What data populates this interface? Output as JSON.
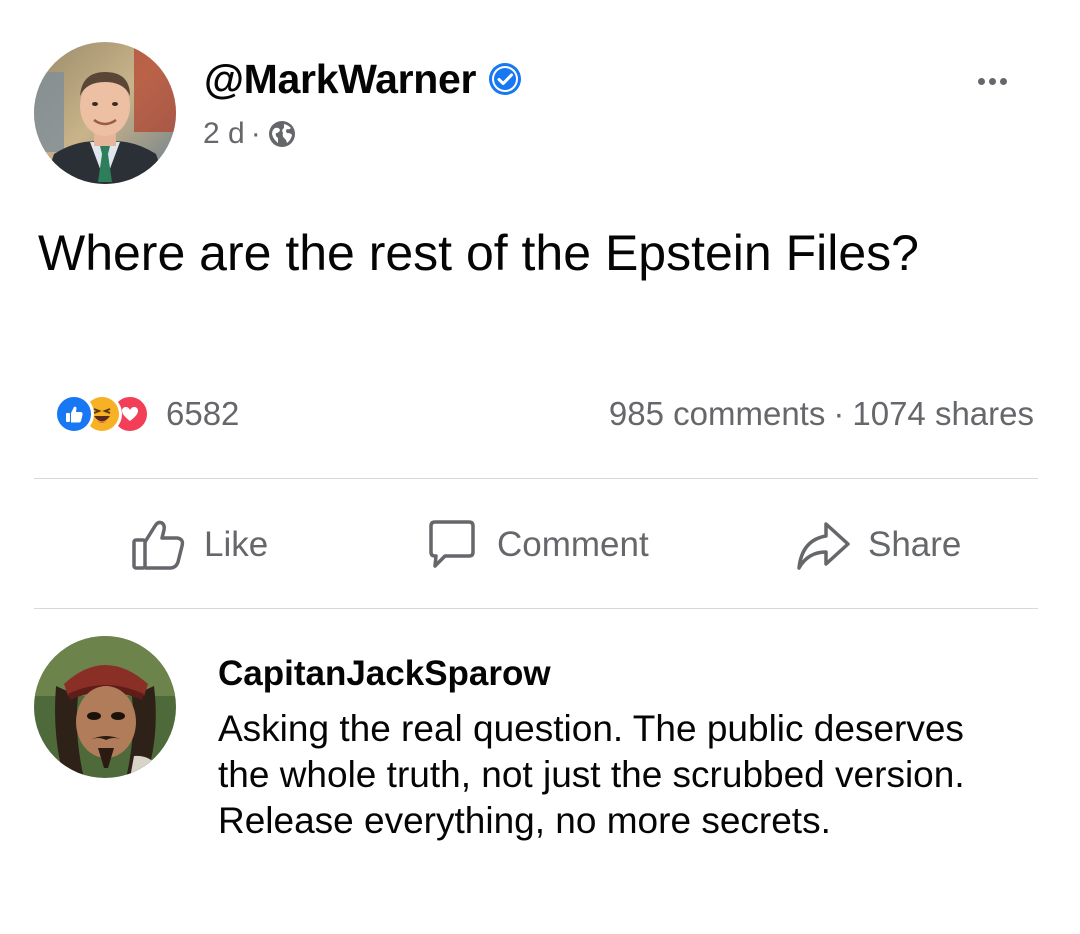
{
  "post": {
    "author": "@MarkWarner",
    "verified": true,
    "time": "2 d",
    "separator": "·",
    "audience_icon": "globe-icon",
    "more_icon": "more-options-icon",
    "text": "Where are the rest of the Epstein Files?",
    "reactions": {
      "types": [
        "like",
        "haha",
        "love"
      ],
      "count": "6582"
    },
    "comments_count": "985 comments",
    "count_separator": "·",
    "shares_count": "1074 shares"
  },
  "actions": {
    "like_label": "Like",
    "comment_label": "Comment",
    "share_label": "Share"
  },
  "comment": {
    "author": "CapitanJackSparow",
    "text": "Asking the real question. The public deserves the whole truth, not just the scrubbed version. Release everything, no more secrets."
  },
  "colors": {
    "verified_blue": "#1877f2",
    "like_blue": "#1877f2",
    "haha_yellow": "#f7b125",
    "love_red": "#f33e58",
    "secondary_text": "#65676b",
    "divider": "#d6d8db"
  }
}
